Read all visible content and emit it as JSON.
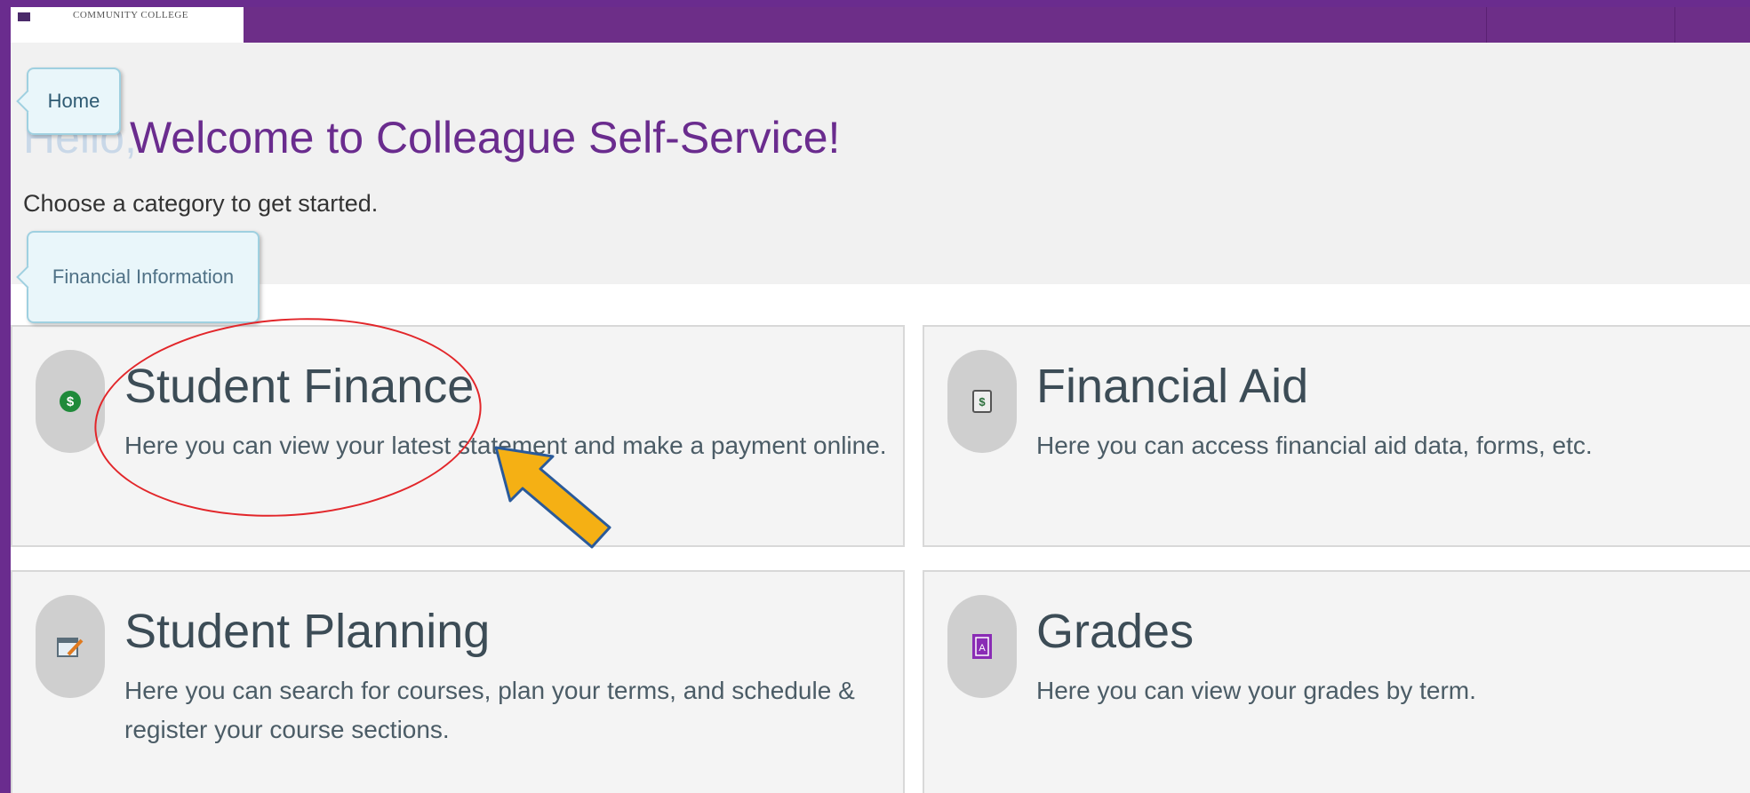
{
  "header": {
    "logo_text": "COMMUNITY COLLEGE"
  },
  "greeting": {
    "hello": "Hello,",
    "title": "Welcome to Colleague Self-Service!",
    "subtitle": "Choose a category to get started."
  },
  "tooltips": {
    "home": "Home",
    "financial_info": "Financial Information"
  },
  "cards": [
    {
      "title": "Student Finance",
      "description": "Here you can view your latest statement and make a payment online.",
      "icon": "dollar-icon"
    },
    {
      "title": "Financial Aid",
      "description": "Here you can access financial aid data, forms, etc.",
      "icon": "financial-aid-icon"
    },
    {
      "title": "Student Planning",
      "description": "Here you can search for courses, plan your terms, and schedule & register your course sections.",
      "icon": "calendar-icon"
    },
    {
      "title": "Grades",
      "description": "Here you can view your grades by term.",
      "icon": "grades-icon"
    }
  ],
  "colors": {
    "brand_purple": "#6a2c8e",
    "annotation_red": "#e2262a",
    "arrow_orange": "#f5b014"
  }
}
